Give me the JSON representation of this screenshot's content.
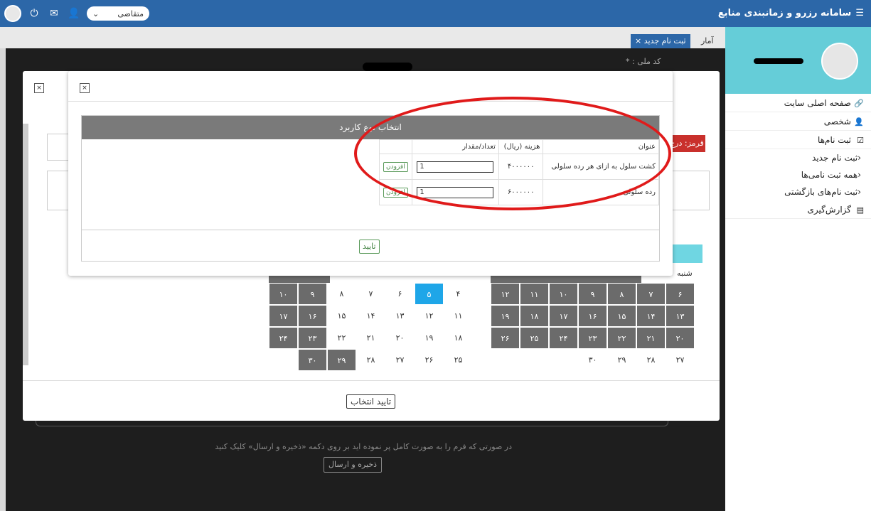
{
  "app": {
    "title": "سامانه رزرو و زمانبندی منابع"
  },
  "topbar": {
    "role": "متقاضی"
  },
  "sidebar": {
    "items": [
      {
        "label": "صفحه اصلی سایت",
        "icon": "link-icon"
      },
      {
        "label": "شخصی",
        "icon": "user-icon"
      },
      {
        "label": "ثبت نام‌ها",
        "icon": "check-square-icon"
      },
      {
        "label": "ثبت نام جدید",
        "icon": "chevron-left-icon"
      },
      {
        "label": "همه ثبت نامی‌ها",
        "icon": "chevron-left-icon"
      },
      {
        "label": "ثبت نام‌های بازگشتی",
        "icon": "chevron-left-icon"
      },
      {
        "label": "گزارش‌گیری",
        "icon": "report-icon"
      }
    ]
  },
  "tabs": {
    "stats": "آمار",
    "new_registration": "ثبت نام جدید"
  },
  "form": {
    "national_id_label": "کد ملی : *",
    "red_badge": "قرمز: درج"
  },
  "calendar": {
    "saturday": "شنبه",
    "right": [
      [
        "۶",
        "۷",
        "۸",
        "۹",
        "۱۰",
        "۱۱",
        "۱۲"
      ],
      [
        "۱۳",
        "۱۴",
        "۱۵",
        "۱۶",
        "۱۷",
        "۱۸",
        "۱۹"
      ],
      [
        "۲۰",
        "۲۱",
        "۲۲",
        "۲۳",
        "۲۴",
        "۲۵",
        "۲۶"
      ],
      [
        "۲۷",
        "۲۸",
        "۲۹",
        "۳۰",
        "",
        "",
        ""
      ]
    ],
    "left": [
      [
        "۴",
        "۵",
        "۶",
        "۷",
        "۸",
        "۹",
        "۱۰"
      ],
      [
        "۱۱",
        "۱۲",
        "۱۳",
        "۱۴",
        "۱۵",
        "۱۶",
        "۱۷"
      ],
      [
        "۱۸",
        "۱۹",
        "۲۰",
        "۲۱",
        "۲۲",
        "۲۳",
        "۲۴"
      ],
      [
        "۲۵",
        "۲۶",
        "۲۷",
        "۲۸",
        "۲۹",
        "۳۰",
        ""
      ]
    ]
  },
  "outer_modal": {
    "close": "×",
    "confirm_selection": "تایید انتخاب"
  },
  "inner_modal": {
    "close": "×",
    "panel_title": "انتخاب نوع کاربرد",
    "columns": {
      "title": "عنوان",
      "cost": "هزینه (ریال)",
      "quantity": "تعداد/مقدار"
    },
    "rows": [
      {
        "title": "کشت سلول به ازای هر رده سلولی",
        "cost": "۴۰۰۰۰۰۰",
        "quantity": "1",
        "add": "افزودن"
      },
      {
        "title": "رده سلولی",
        "cost": "۶۰۰۰۰۰۰",
        "quantity": "1",
        "add": "افزودن"
      }
    ],
    "confirm": "تایید"
  },
  "footer": {
    "note": "در صورتی که فرم را به صورت کامل پر نموده اید بر روی دکمه «ذخیره و ارسال» کلیک کنید",
    "save": "ذخیره و ارسال"
  },
  "colors": {
    "brand": "#2c67a8",
    "accent": "#65cdd8",
    "selected": "#1ea6e8",
    "highlight": "#e01a1a"
  }
}
